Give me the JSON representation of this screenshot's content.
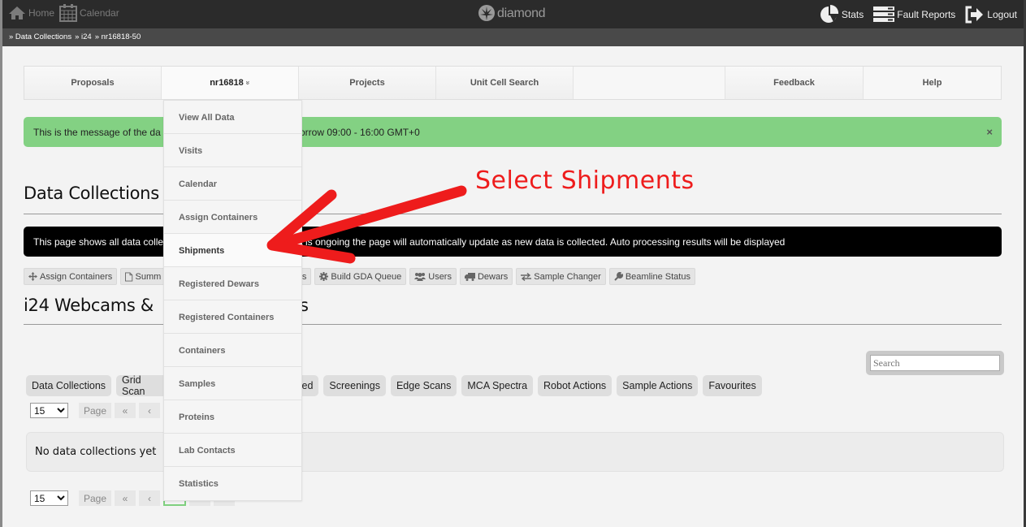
{
  "topbar": {
    "left_links": [
      {
        "label": "Home",
        "icon": "home-icon"
      },
      {
        "label": "Calendar",
        "icon": "calendar-icon"
      }
    ],
    "logo_text": "diamond",
    "right_links": [
      {
        "label": "Stats",
        "icon": "pie-chart-icon"
      },
      {
        "label": "Fault Reports",
        "icon": "server-icon"
      },
      {
        "label": "Logout",
        "icon": "logout-icon"
      }
    ]
  },
  "breadcrumb": [
    "» Data Collections",
    "» i24",
    "» nr16818-50"
  ],
  "mainnav": {
    "items": [
      {
        "label": "Proposals"
      },
      {
        "label": "nr16818",
        "caret": "»"
      },
      {
        "label": "Projects"
      },
      {
        "label": "Unit Cell Search"
      },
      {
        "label": ""
      },
      {
        "label": "Feedback"
      },
      {
        "label": "Help"
      }
    ]
  },
  "dropdown": {
    "items": [
      "View All Data",
      "Visits",
      "Calendar",
      "Assign Containers",
      "Shipments",
      "Registered Dewars",
      "Registered Containers",
      "Containers",
      "Samples",
      "Proteins",
      "Lab Contacts",
      "Statistics"
    ],
    "highlighted": "Shipments"
  },
  "alert": {
    "message": "This is the message of the day: Scheduled maintenance tomorrow 09:00 - 16:00 GMT+0",
    "visible_left": "This is the message of the da",
    "visible_right": "orrow 09:00 - 16:00 GMT+0",
    "close": "×",
    "color": "#83d183"
  },
  "headings": {
    "data_collections": "Data Collections",
    "webcams": "i24 Webcams & ",
    "webcams_tail": "s"
  },
  "infobar": {
    "visible_left": "This page shows all data colle",
    "visible_right": "e visit is ongoing the page will automatically update as new data is collected. Auto processing results will be displayed"
  },
  "action_buttons": [
    {
      "label": "Assign Containers",
      "icon": "move-icon"
    },
    {
      "label": "Summ",
      "icon": "file-icon"
    },
    {
      "label": "sit Stats",
      "icon": ""
    },
    {
      "label": "Build GDA Queue",
      "icon": "gear-icon"
    },
    {
      "label": "Users",
      "icon": "users-icon"
    },
    {
      "label": "Dewars",
      "icon": "truck-icon"
    },
    {
      "label": "Sample Changer",
      "icon": "exchange-icon"
    },
    {
      "label": "Beamline Status",
      "icon": "wrench-icon"
    }
  ],
  "tabs": [
    "Data Collections",
    "Grid Scan",
    "egrated",
    "Screenings",
    "Edge Scans",
    "MCA Spectra",
    "Robot Actions",
    "Sample Actions",
    "Favourites"
  ],
  "search": {
    "placeholder": "Search",
    "value": ""
  },
  "pager": {
    "per_page": "15",
    "page_label": "Page",
    "first": "«",
    "prev": "‹",
    "current": "1",
    "next": "›",
    "last": "»"
  },
  "empty_message": "No data collections yet",
  "annotation": {
    "text": "Select Shipments",
    "color": "#ee1c1c"
  }
}
